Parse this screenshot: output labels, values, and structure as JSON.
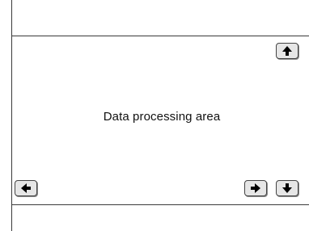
{
  "content": {
    "area_label": "Data processing area"
  },
  "controls": {
    "scroll_up": {
      "icon": "arrow-up-icon"
    },
    "scroll_left": {
      "icon": "arrow-left-icon"
    },
    "scroll_right": {
      "icon": "arrow-right-icon"
    },
    "scroll_down": {
      "icon": "arrow-down-icon"
    }
  },
  "colors": {
    "line": "#3a3a3a",
    "button_fill": "#e6e6e6",
    "arrow": "#000000"
  }
}
